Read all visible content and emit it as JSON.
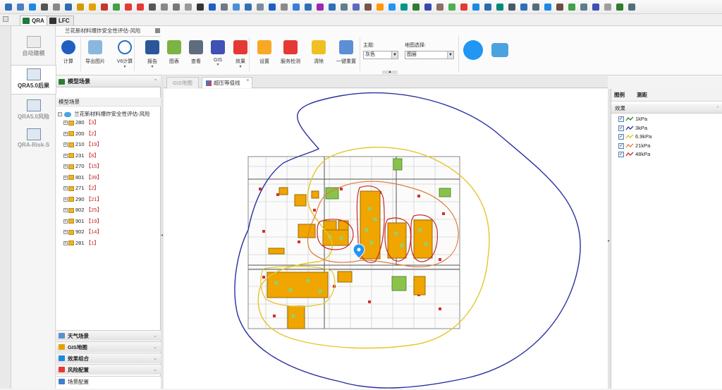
{
  "app_tabs": [
    {
      "label": "QRA"
    },
    {
      "label": "LFC"
    }
  ],
  "left_nav": [
    {
      "label": "自动建模"
    },
    {
      "label": "QRA5.0后果"
    },
    {
      "label": "QRA5.0风险"
    },
    {
      "label": "QRA-Risk-S"
    }
  ],
  "ribbon": {
    "document_title": "兰花新材料爆炸安全性评估-风险",
    "buttons": [
      {
        "label": "计算",
        "icon": "play-icon",
        "color": "#1e5fbf"
      },
      {
        "label": "导出图片",
        "icon": "image-icon",
        "color": "#8bb6e0"
      },
      {
        "label": "V6计算",
        "icon": "refresh-icon",
        "color": "#2c6fc4"
      },
      {
        "label": "报告",
        "icon": "word-icon",
        "color": "#2b579a"
      },
      {
        "label": "图表",
        "icon": "chart-icon",
        "color": "#7cb342"
      },
      {
        "label": "查看",
        "icon": "grid-icon",
        "color": "#5d6d7e"
      },
      {
        "label": "GIS",
        "icon": "globe-icon",
        "color": "#3f51b5"
      },
      {
        "label": "效果",
        "icon": "effect-icon",
        "color": "#e53935"
      },
      {
        "label": "设置",
        "icon": "gear-icon",
        "color": "#f9a825"
      },
      {
        "label": "服务检测",
        "icon": "monitor-icon",
        "color": "#e53935"
      },
      {
        "label": "清除",
        "icon": "eraser-icon",
        "color": "#f0c020"
      },
      {
        "label": "一键重置",
        "icon": "reset-icon",
        "color": "#5c8fd6"
      }
    ],
    "theme_label": "主题:",
    "theme_value": "灰色",
    "map_label": "地图选择:",
    "map_value": "图层"
  },
  "left_panel": {
    "title": "模型场景",
    "subheader": "模型场景",
    "root": "兰花新材料爆炸安全性评估-风险",
    "items": [
      {
        "code": "280",
        "count": "【3】"
      },
      {
        "code": "200",
        "count": "【2】"
      },
      {
        "code": "210",
        "count": "【19】"
      },
      {
        "code": "231",
        "count": "【8】"
      },
      {
        "code": "270",
        "count": "【15】"
      },
      {
        "code": "801",
        "count": "【39】"
      },
      {
        "code": "271",
        "count": "【2】"
      },
      {
        "code": "290",
        "count": "【21】"
      },
      {
        "code": "802",
        "count": "【25】"
      },
      {
        "code": "901",
        "count": "【19】"
      },
      {
        "code": "902",
        "count": "【14】"
      },
      {
        "code": "281",
        "count": "【1】"
      }
    ],
    "accordions": [
      {
        "label": "天气场景"
      },
      {
        "label": "GIS地图"
      },
      {
        "label": "效果组合"
      },
      {
        "label": "风险配置"
      },
      {
        "label": "场景配置"
      }
    ]
  },
  "doc_tabs": [
    {
      "label": "GIS地图"
    },
    {
      "label": "超压等值线"
    }
  ],
  "right_panel": {
    "tabs": [
      {
        "label": "图例"
      },
      {
        "label": "测距"
      }
    ],
    "section_title": "效果",
    "legend": [
      {
        "label": "1kPa",
        "color": "#2e7d32"
      },
      {
        "label": "3kPa",
        "color": "#283593"
      },
      {
        "label": "6.9kPa",
        "color": "#d4c21c"
      },
      {
        "label": "21kPa",
        "color": "#e07b39"
      },
      {
        "label": "48kPa",
        "color": "#c62828"
      }
    ]
  }
}
